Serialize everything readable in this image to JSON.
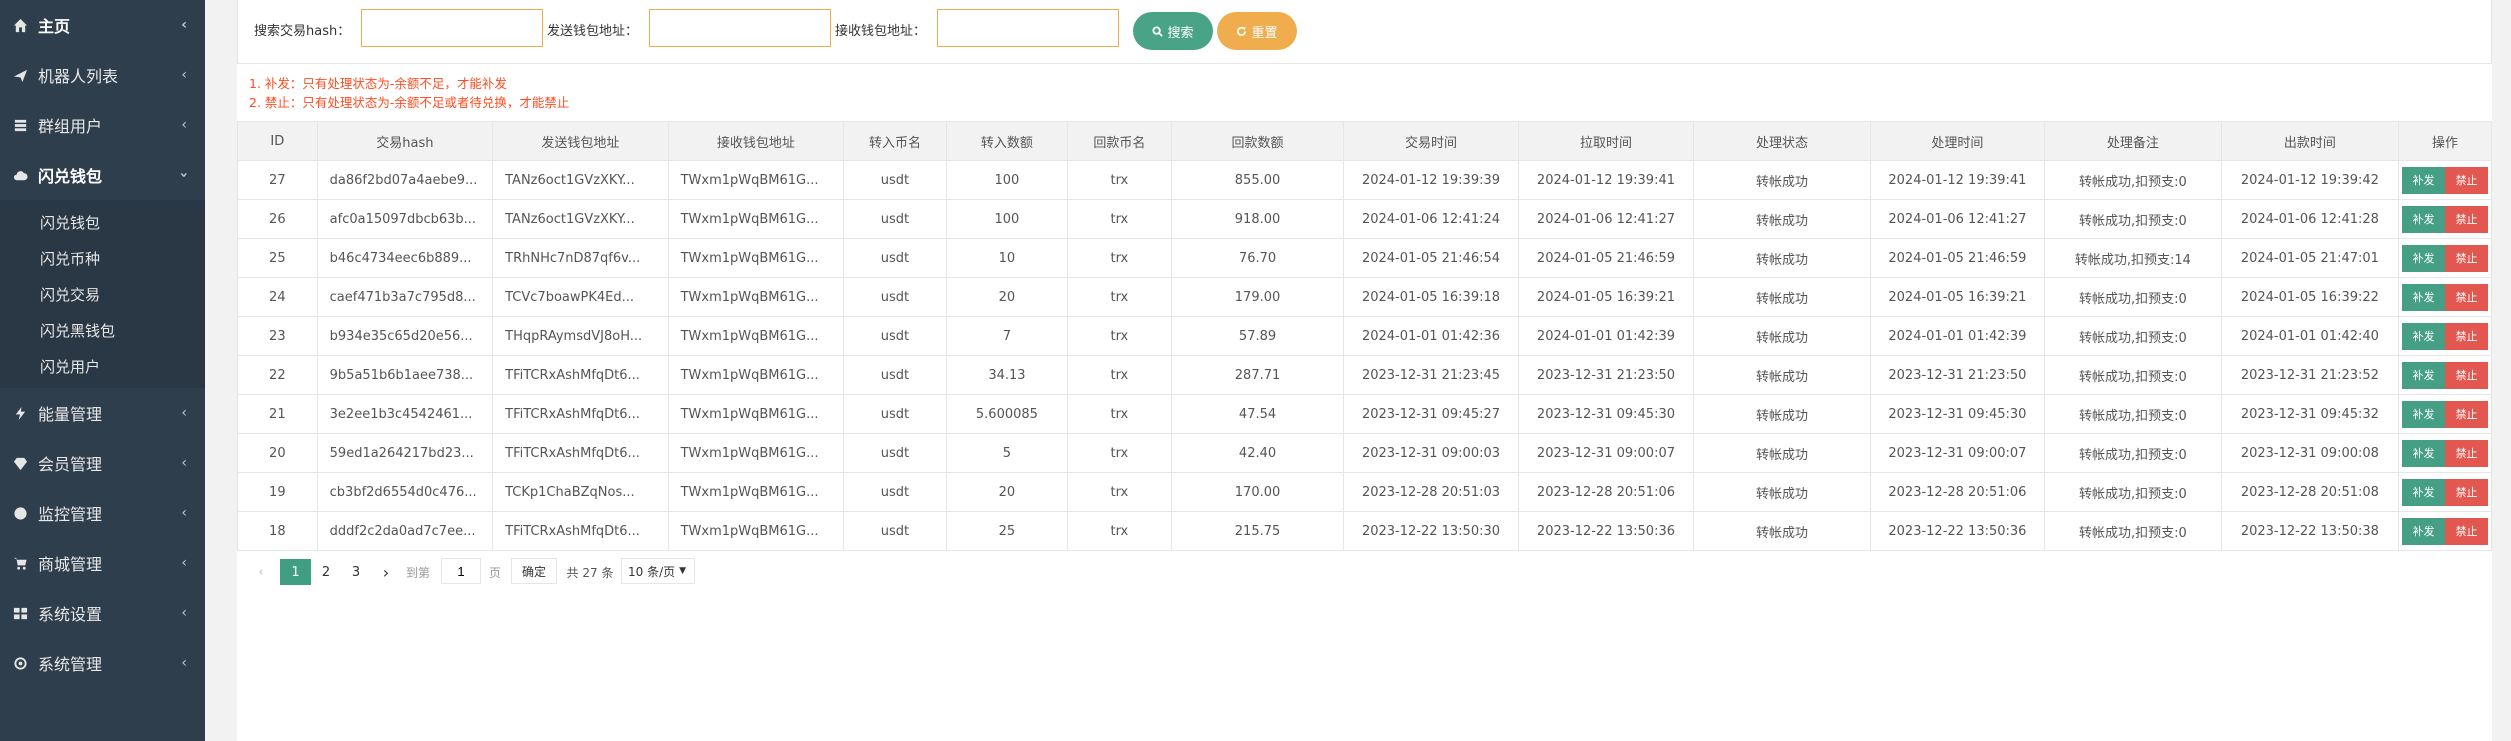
{
  "sidebar": {
    "items": [
      {
        "label": "主页",
        "icon": "home-icon"
      },
      {
        "label": "机器人列表",
        "icon": "robot-icon"
      },
      {
        "label": "群组用户",
        "icon": "group-icon"
      },
      {
        "label": "闪兑钱包",
        "icon": "cloud-icon"
      },
      {
        "label": "能量管理",
        "icon": "energy-icon"
      },
      {
        "label": "会员管理",
        "icon": "diamond-icon"
      },
      {
        "label": "监控管理",
        "icon": "monitor-icon"
      },
      {
        "label": "商城管理",
        "icon": "cart-icon"
      },
      {
        "label": "系统设置",
        "icon": "grid-icon"
      },
      {
        "label": "系统管理",
        "icon": "gear-icon"
      }
    ],
    "submenu": [
      "闪兑钱包",
      "闪兑币种",
      "闪兑交易",
      "闪兑黑钱包",
      "闪兑用户"
    ]
  },
  "search": {
    "hash_label": "搜索交易hash：",
    "send_label": "发送钱包地址：",
    "recv_label": "接收钱包地址：",
    "search_btn": "搜索",
    "reset_btn": "重置"
  },
  "notes": [
    "1. 补发：只有处理状态为-余额不足，才能补发",
    "2. 禁止：只有处理状态为-余额不足或者待兑换，才能禁止"
  ],
  "table": {
    "headers": [
      "ID",
      "交易hash",
      "发送钱包地址",
      "接收钱包地址",
      "转入币名",
      "转入数额",
      "回款币名",
      "回款数额",
      "交易时间",
      "拉取时间",
      "处理状态",
      "处理时间",
      "处理备注",
      "出款时间",
      "操作"
    ],
    "rows": [
      [
        "27",
        "da86f2bd07a4aebe9...",
        "TANz6oct1GVzXKY...",
        "TWxm1pWqBM61G...",
        "usdt",
        "100",
        "trx",
        "855.00",
        "2024-01-12 19:39:39",
        "2024-01-12 19:39:41",
        "转帐成功",
        "2024-01-12 19:39:41",
        "转帐成功,扣预支:0",
        "2024-01-12 19:39:42"
      ],
      [
        "26",
        "afc0a15097dbcb63b...",
        "TANz6oct1GVzXKY...",
        "TWxm1pWqBM61G...",
        "usdt",
        "100",
        "trx",
        "918.00",
        "2024-01-06 12:41:24",
        "2024-01-06 12:41:27",
        "转帐成功",
        "2024-01-06 12:41:27",
        "转帐成功,扣预支:0",
        "2024-01-06 12:41:28"
      ],
      [
        "25",
        "b46c4734eec6b889...",
        "TRhNHc7nD87qf6v...",
        "TWxm1pWqBM61G...",
        "usdt",
        "10",
        "trx",
        "76.70",
        "2024-01-05 21:46:54",
        "2024-01-05 21:46:59",
        "转帐成功",
        "2024-01-05 21:46:59",
        "转帐成功,扣预支:14",
        "2024-01-05 21:47:01"
      ],
      [
        "24",
        "caef471b3a7c795d8...",
        "TCVc7boawPK4Ed...",
        "TWxm1pWqBM61G...",
        "usdt",
        "20",
        "trx",
        "179.00",
        "2024-01-05 16:39:18",
        "2024-01-05 16:39:21",
        "转帐成功",
        "2024-01-05 16:39:21",
        "转帐成功,扣预支:0",
        "2024-01-05 16:39:22"
      ],
      [
        "23",
        "b934e35c65d20e56...",
        "THqpRAymsdVJ8oH...",
        "TWxm1pWqBM61G...",
        "usdt",
        "7",
        "trx",
        "57.89",
        "2024-01-01 01:42:36",
        "2024-01-01 01:42:39",
        "转帐成功",
        "2024-01-01 01:42:39",
        "转帐成功,扣预支:0",
        "2024-01-01 01:42:40"
      ],
      [
        "22",
        "9b5a51b6b1aee738...",
        "TFiTCRxAshMfqDt6...",
        "TWxm1pWqBM61G...",
        "usdt",
        "34.13",
        "trx",
        "287.71",
        "2023-12-31 21:23:45",
        "2023-12-31 21:23:50",
        "转帐成功",
        "2023-12-31 21:23:50",
        "转帐成功,扣预支:0",
        "2023-12-31 21:23:52"
      ],
      [
        "21",
        "3e2ee1b3c4542461...",
        "TFiTCRxAshMfqDt6...",
        "TWxm1pWqBM61G...",
        "usdt",
        "5.600085",
        "trx",
        "47.54",
        "2023-12-31 09:45:27",
        "2023-12-31 09:45:30",
        "转帐成功",
        "2023-12-31 09:45:30",
        "转帐成功,扣预支:0",
        "2023-12-31 09:45:32"
      ],
      [
        "20",
        "59ed1a264217bd23...",
        "TFiTCRxAshMfqDt6...",
        "TWxm1pWqBM61G...",
        "usdt",
        "5",
        "trx",
        "42.40",
        "2023-12-31 09:00:03",
        "2023-12-31 09:00:07",
        "转帐成功",
        "2023-12-31 09:00:07",
        "转帐成功,扣预支:0",
        "2023-12-31 09:00:08"
      ],
      [
        "19",
        "cb3bf2d6554d0c476...",
        "TCKp1ChaBZqNos...",
        "TWxm1pWqBM61G...",
        "usdt",
        "20",
        "trx",
        "170.00",
        "2023-12-28 20:51:03",
        "2023-12-28 20:51:06",
        "转帐成功",
        "2023-12-28 20:51:06",
        "转帐成功,扣预支:0",
        "2023-12-28 20:51:08"
      ],
      [
        "18",
        "dddf2c2da0ad7c7ee...",
        "TFiTCRxAshMfqDt6...",
        "TWxm1pWqBM61G...",
        "usdt",
        "25",
        "trx",
        "215.75",
        "2023-12-22 13:50:30",
        "2023-12-22 13:50:36",
        "转帐成功",
        "2023-12-22 13:50:36",
        "转帐成功,扣预支:0",
        "2023-12-22 13:50:38"
      ]
    ],
    "action_reissue": "补发",
    "action_ban": "禁止"
  },
  "pager": {
    "pages": [
      "1",
      "2",
      "3"
    ],
    "current": "1",
    "goto_label": "到第",
    "goto_value": "1",
    "page_unit": "页",
    "confirm": "确定",
    "total": "共 27 条",
    "per_page": "10 条/页",
    "prev": "‹",
    "next": "›"
  },
  "colors": {
    "sidebar": "#2f3e4c",
    "accent_green": "#49a386",
    "accent_orange": "#f0ad4e",
    "danger": "#e2574f",
    "note_red": "#ff4d21"
  }
}
